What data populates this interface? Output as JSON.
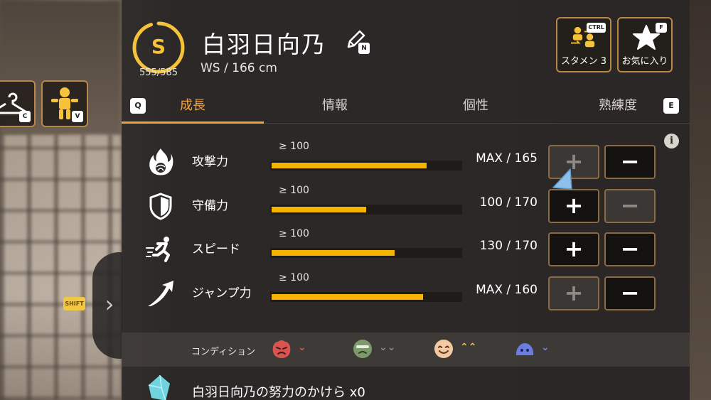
{
  "header": {
    "rank": "S",
    "rank_progress": "555/585",
    "rank_progress_value": 0.949,
    "name": "白羽日向乃",
    "edit_key": "N",
    "position_height": "WS  /  166 cm"
  },
  "left_buttons": {
    "outfit_key": "C",
    "pose_key": "V"
  },
  "top_buttons": {
    "starter": {
      "label": "スタメン 3",
      "key": "CTRL",
      "icon": "team-swap-icon"
    },
    "favorite": {
      "label": "お気に入り",
      "key": "F",
      "icon": "star-icon"
    }
  },
  "tabs": {
    "prev_key": "Q",
    "next_key": "E",
    "items": [
      {
        "label": "成長",
        "active": true
      },
      {
        "label": "情報",
        "active": false
      },
      {
        "label": "個性",
        "active": false
      },
      {
        "label": "熟練度",
        "active": false
      }
    ]
  },
  "stats": [
    {
      "label": "攻撃力",
      "threshold": "≥ 100",
      "value_text": "MAX / 165",
      "fill": 0.82,
      "plus_enabled": false,
      "minus_enabled": true,
      "icon": "attack-flame-icon"
    },
    {
      "label": "守備力",
      "threshold": "≥ 100",
      "value_text": "100 / 170",
      "fill": 0.5,
      "plus_enabled": true,
      "minus_enabled": false,
      "icon": "defense-shield-icon"
    },
    {
      "label": "スピード",
      "threshold": "≥ 100",
      "value_text": "130 / 170",
      "fill": 0.65,
      "plus_enabled": true,
      "minus_enabled": true,
      "icon": "speed-runner-icon"
    },
    {
      "label": "ジャンプ力",
      "threshold": "≥ 100",
      "value_text": "MAX / 160",
      "fill": 0.8,
      "plus_enabled": false,
      "minus_enabled": true,
      "icon": "jump-arrow-icon"
    }
  ],
  "stat_buttons": {
    "plus": "+",
    "minus": "−"
  },
  "condition": {
    "label": "コンディション",
    "items": [
      {
        "face": "angry-face-icon",
        "color": "#d9534f",
        "arrow": "⌄",
        "arrow_color": "#e05b55"
      },
      {
        "face": "tired-face-icon",
        "color": "#7d9a6a",
        "arrow": "⌄⌄",
        "arrow_color": "#8c8c8c"
      },
      {
        "face": "happy-face-icon",
        "color": "#f2c9a0",
        "arrow": "⌃⌃",
        "arrow_color": "#f3c24a"
      },
      {
        "face": "blob-face-icon",
        "color": "#6a7de0",
        "arrow": "⌄",
        "arrow_color": "#6f86e8"
      }
    ]
  },
  "effort": {
    "text": "白羽日向乃の努力のかけら  x0",
    "icon": "crystal-shard-icon"
  },
  "side": {
    "shift_key": "SHIFT",
    "expand_icon": "chevron-right-icon"
  },
  "colors": {
    "accent": "#f0a33a",
    "bar": "#f5b400",
    "frame": "#b8884a"
  }
}
